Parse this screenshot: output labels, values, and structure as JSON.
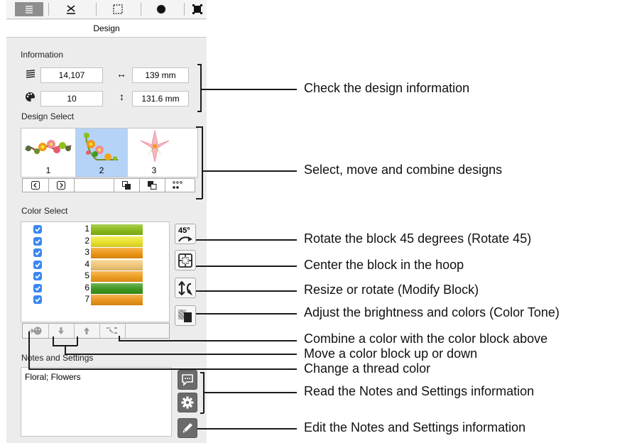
{
  "tabs": [
    {
      "icon": "design-tab-icon",
      "selected": true
    },
    {
      "icon": "scissors-icon",
      "selected": false
    },
    {
      "icon": "selection-icon",
      "selected": false
    },
    {
      "icon": "circle-icon",
      "selected": false
    },
    {
      "icon": "frame-icon",
      "selected": false
    }
  ],
  "design_tab_label": "Design",
  "information": {
    "label": "Information",
    "stitches": "14,107",
    "width": "139 mm",
    "colors": "10",
    "height": "131.6 mm"
  },
  "design_select": {
    "label": "Design Select",
    "items": [
      {
        "num": "1",
        "selected": false
      },
      {
        "num": "2",
        "selected": true
      },
      {
        "num": "3",
        "selected": false
      }
    ]
  },
  "color_select": {
    "label": "Color Select",
    "rows": [
      {
        "num": "1",
        "color": "#8ec11a",
        "checked": true
      },
      {
        "num": "2",
        "color": "#f2ea2c",
        "checked": true
      },
      {
        "num": "3",
        "color": "#f59a12",
        "checked": true
      },
      {
        "num": "4",
        "color": "#f9cd7d",
        "checked": true
      },
      {
        "num": "5",
        "color": "#f6a21e",
        "checked": true
      },
      {
        "num": "6",
        "color": "#3e9b1e",
        "checked": true
      },
      {
        "num": "7",
        "color": "#f39a1a",
        "checked": true
      }
    ]
  },
  "notes": {
    "label": "Notes and Settings",
    "text": "Floral;  Flowers"
  },
  "callouts": {
    "info": "Check the design information",
    "select": "Select, move and combine designs",
    "rotate45": "Rotate the block 45 degrees (Rotate 45)",
    "center": "Center the block in the hoop",
    "modify": "Resize or rotate (Modify Block)",
    "tone": "Adjust the brightness and colors (Color Tone)",
    "combine": "Combine a color with the color block above",
    "move": "Move a color block up or down",
    "change": "Change a thread color",
    "read": "Read the Notes and Settings information",
    "edit": "Edit the Notes and Settings information"
  },
  "rotate_label": "45°",
  "accent_color": "#3a86f3",
  "selected_thumb_color": "#b5d3f7"
}
